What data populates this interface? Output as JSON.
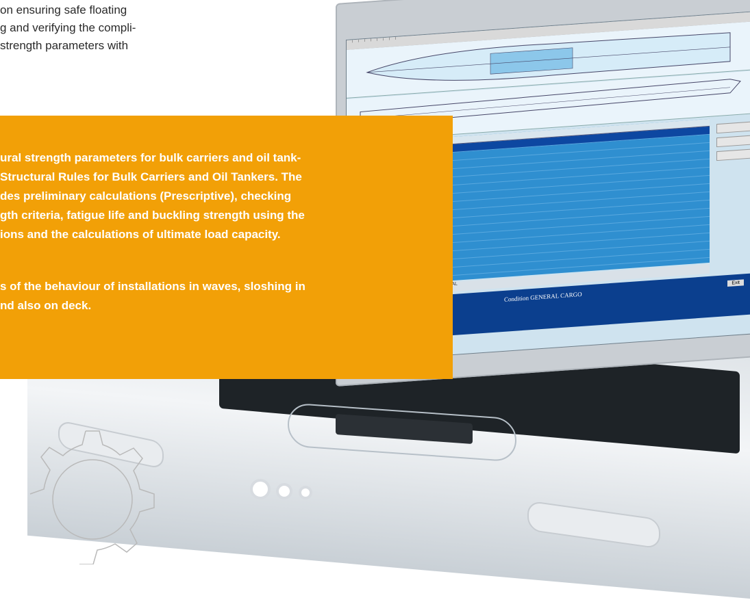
{
  "intro": {
    "lines": [
      "on ensuring safe floating",
      "g and verifying the compli-",
      "strength parameters with"
    ]
  },
  "orange_panel": {
    "paragraph1_lines": [
      "ural strength parameters for bulk carriers and oil tank-",
      "Structural Rules for Bulk Carriers and Oil Tankers. The",
      "des preliminary calculations (Prescriptive), checking",
      "gth criteria, fatigue life and buckling strength using the",
      "ions and the calculations of ultimate load capacity."
    ],
    "paragraph2_lines": [
      "s of the behaviour of installations in waves, sloshing in",
      "nd also on deck."
    ]
  },
  "screen": {
    "total_label": "TOTAL",
    "condition_label": "Condition GENERAL CARGO",
    "exit_label": "Exit"
  },
  "colors": {
    "accent": "#f2a007",
    "text": "#2a2a2a",
    "screen_status": "#0b3f8e"
  },
  "icons": [
    "gear-icon"
  ]
}
